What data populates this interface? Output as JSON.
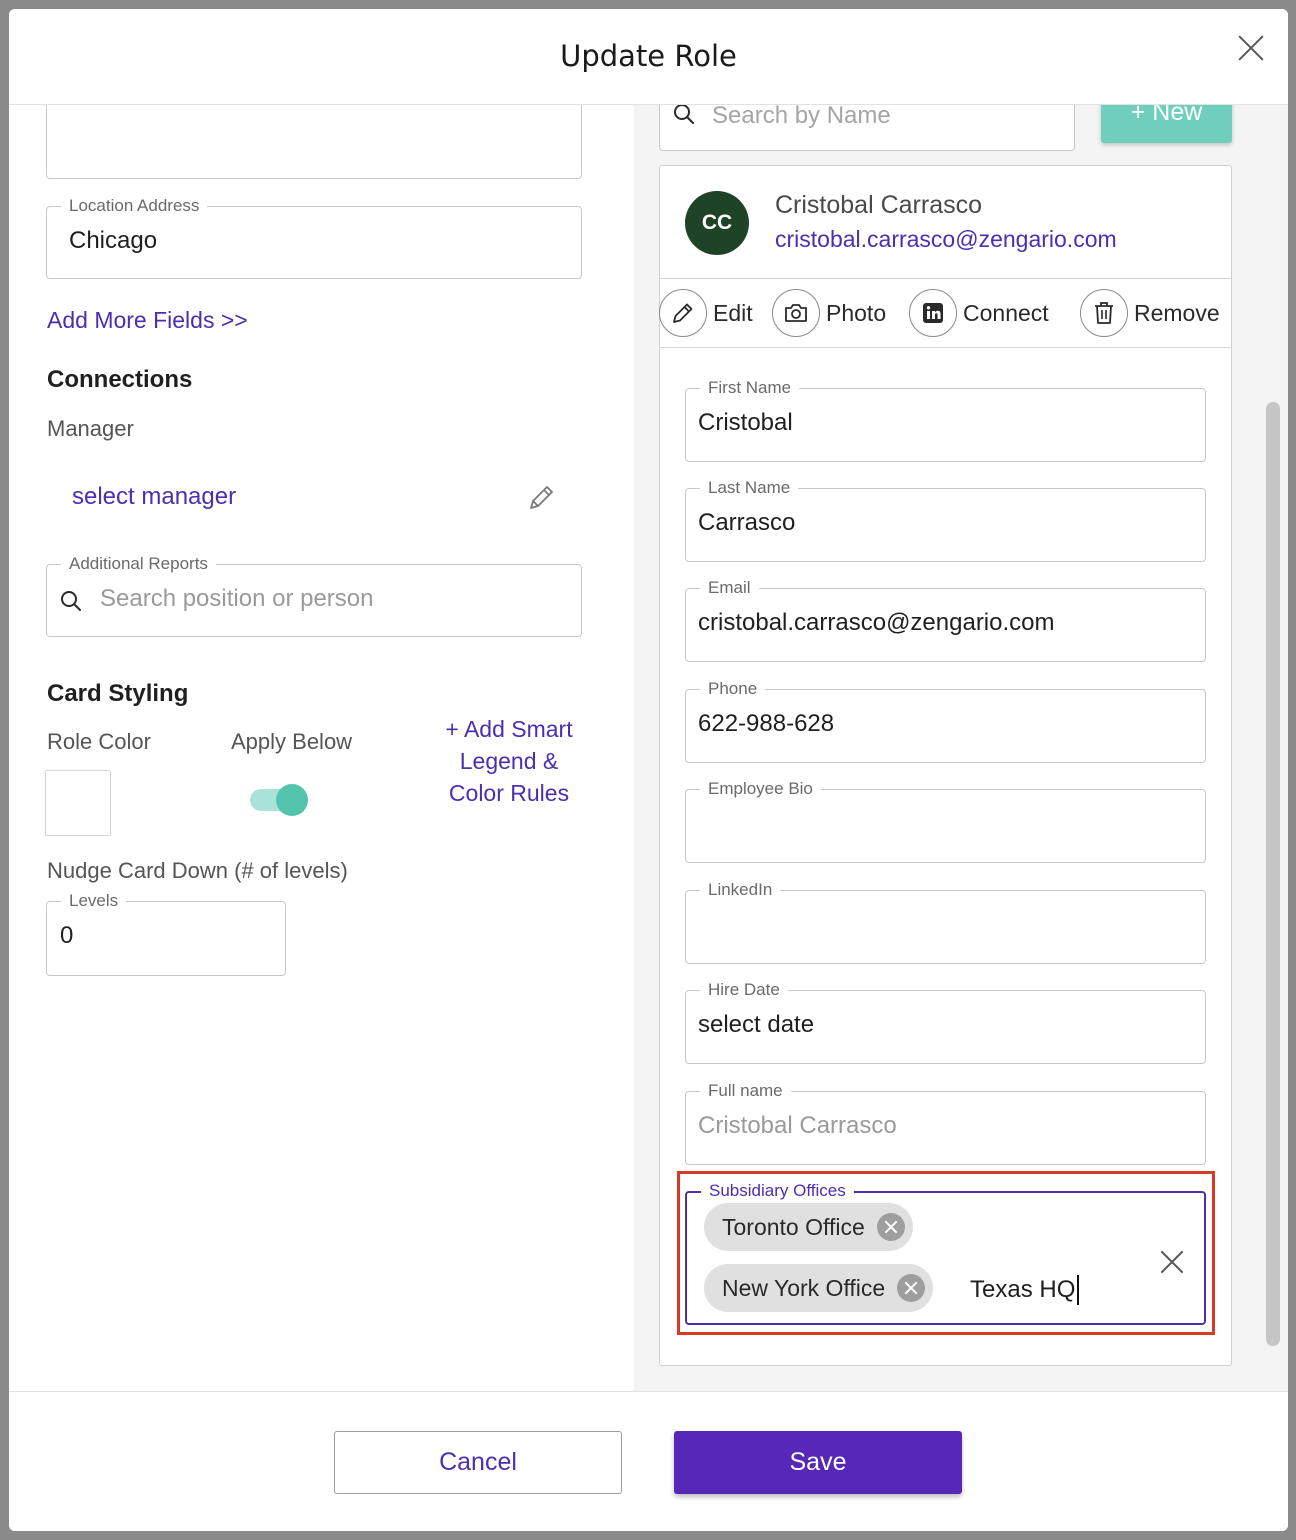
{
  "modal": {
    "title": "Update Role"
  },
  "left": {
    "location_address": {
      "label": "Location Address",
      "value": "Chicago"
    },
    "add_more_fields": "Add More Fields >>",
    "connections": {
      "heading": "Connections",
      "manager_label": "Manager",
      "select_manager": "select manager",
      "additional_reports": {
        "label": "Additional Reports",
        "placeholder": "Search position or person"
      }
    },
    "card_styling": {
      "heading": "Card Styling",
      "role_color_label": "Role Color",
      "apply_below_label": "Apply Below",
      "apply_below_on": true,
      "smart_legend_link": [
        "+ Add Smart",
        "Legend &",
        "Color Rules"
      ],
      "nudge_label": "Nudge Card Down (# of levels)",
      "levels": {
        "label": "Levels",
        "value": "0"
      }
    }
  },
  "right": {
    "search_placeholder": "Search by Name",
    "new_button": "+ New",
    "person": {
      "initials": "CC",
      "name": "Cristobal Carrasco",
      "email": "cristobal.carrasco@zengario.com"
    },
    "actions": {
      "edit": "Edit",
      "photo": "Photo",
      "connect": "Connect",
      "remove": "Remove"
    },
    "fields": {
      "first_name": {
        "label": "First Name",
        "value": "Cristobal"
      },
      "last_name": {
        "label": "Last Name",
        "value": "Carrasco"
      },
      "email": {
        "label": "Email",
        "value": "cristobal.carrasco@zengario.com"
      },
      "phone": {
        "label": "Phone",
        "value": "622-988-628"
      },
      "employee_bio": {
        "label": "Employee Bio",
        "value": ""
      },
      "linkedin": {
        "label": "LinkedIn",
        "value": ""
      },
      "hire_date": {
        "label": "Hire Date",
        "value": "select date"
      },
      "full_name": {
        "label": "Full name",
        "value": "Cristobal Carrasco"
      }
    },
    "subsidiary_offices": {
      "label": "Subsidiary Offices",
      "chips": [
        "Toronto Office",
        "New York Office"
      ],
      "input_value": "Texas HQ"
    }
  },
  "footer": {
    "cancel": "Cancel",
    "save": "Save"
  },
  "colors": {
    "accent": "#4b2fb0",
    "save_bg": "#5727b8",
    "new_button_bg": "#6fcfbc",
    "toggle_track": "#a9e3d7",
    "toggle_knob": "#55c4ae",
    "avatar_bg": "#1e4326",
    "highlight": "#d93a26"
  }
}
